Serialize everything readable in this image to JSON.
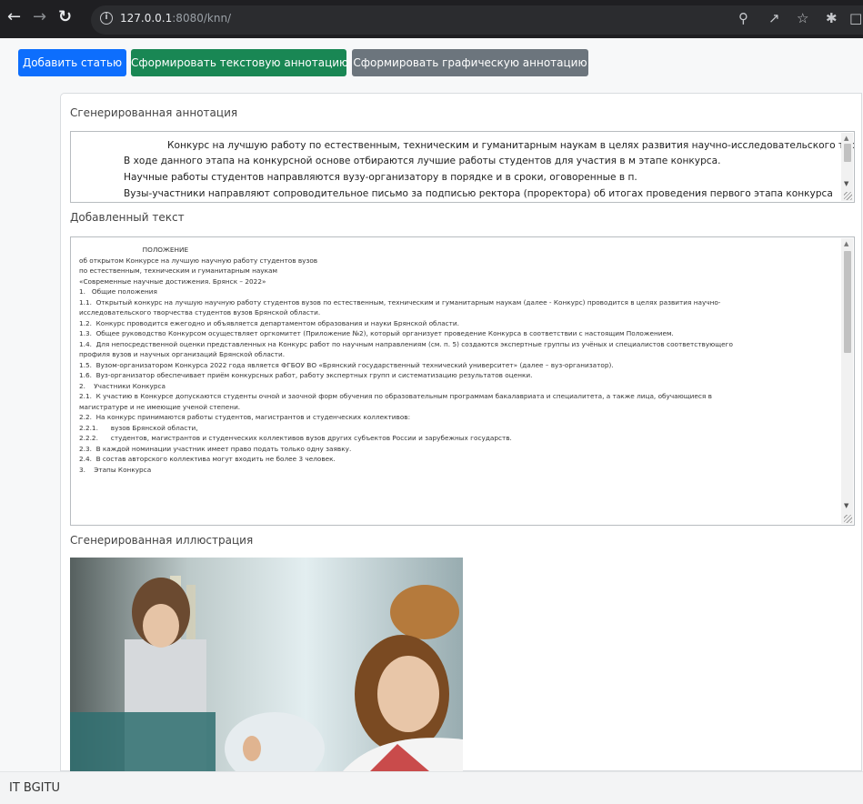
{
  "browser": {
    "url_host": "127.0.0.1",
    "url_rest": ":8080/knn/"
  },
  "toolbar": {
    "add_article": "Добавить статью",
    "text_annotation": "Сформировать текстовую аннотацию",
    "graphic_annotation": "Сформировать графическую аннотацию"
  },
  "annotation": {
    "label": "Сгенерированная аннотация",
    "lines": [
      "Конкурс на лучшую работу по естественным, техническим и гуманитарным наукам в целях развития научно-исследовательского творчества.",
      "В ходе данного этапа на конкурсной основе отбираются лучшие работы студентов для участия в м этапе конкурса.",
      "Научные работы студентов направляются вузу-организатору в порядке и в сроки, оговоренные в п.",
      "Вузы-участники направляют сопроводительное письмо за подписью ректора (проректора) об итогах проведения первого этапа конкурса"
    ]
  },
  "added_text": {
    "label": "Добавленный текст",
    "lines": [
      "                              ПОЛОЖЕНИЕ",
      "об открытом Конкурсе на лучшую научную работу студентов вузов",
      "по естественным, техническим и гуманитарным наукам",
      "«Современные научные достижения. Брянск – 2022»",
      "1.   Общие положения",
      "1.1.  Открытый конкурс на лучшую научную работу студентов вузов по естественным, техническим и гуманитарным наукам (далее - Конкурс) проводится в целях развития научно-",
      "исследовательского творчества студентов вузов Брянской области.",
      "1.2.  Конкурс проводится ежегодно и объявляется департаментом образования и науки Брянской области.",
      "1.3.  Общее руководство Конкурсом осуществляет оргкомитет (Приложение №2), который организует проведение Конкурса в соответствии с настоящим Положением.",
      "1.4.  Для непосредственной оценки представленных на Конкурс работ по научным направлениям (см. п. 5) создаются экспертные группы из учёных и специалистов соответствующего",
      "профиля вузов и научных организаций Брянской области.",
      "1.5.  Вузом-организатором Конкурса 2022 года является ФГБОУ ВО «Брянский государственный технический университет» (далее – вуз-организатор).",
      "1.6.  Вуз-организатор обеспечивает приём конкурсных работ, работу экспертных групп и систематизацию результатов оценки.",
      "2.    Участники Конкурса",
      "2.1.  К участию в Конкурсе допускаются студенты очной и заочной форм обучения по образовательным программам бакалавриата и специалитета, а также лица, обучающиеся в",
      "магистратуре и не имеющие ученой степени.",
      "2.2.  На конкурс принимаются работы студентов, магистрантов и студенческих коллективов:",
      "2.2.1.      вузов Брянской области,",
      "2.2.2.      студентов, магистрантов и студенческих коллективов вузов других субъектов России и зарубежных государств.",
      "2.3.  В каждой номинации участник имеет право подать только одну заявку.",
      "2.4.  В состав авторского коллектива могут входить не более 3 человек.",
      "3.    Этапы Конкурса"
    ]
  },
  "illustration": {
    "label": "Сгенерированная иллюстрация"
  },
  "footer": {
    "text": "IT BGITU"
  },
  "colors": {
    "primary": "#0d6efd",
    "success": "#198754",
    "secondary": "#6c757d"
  }
}
